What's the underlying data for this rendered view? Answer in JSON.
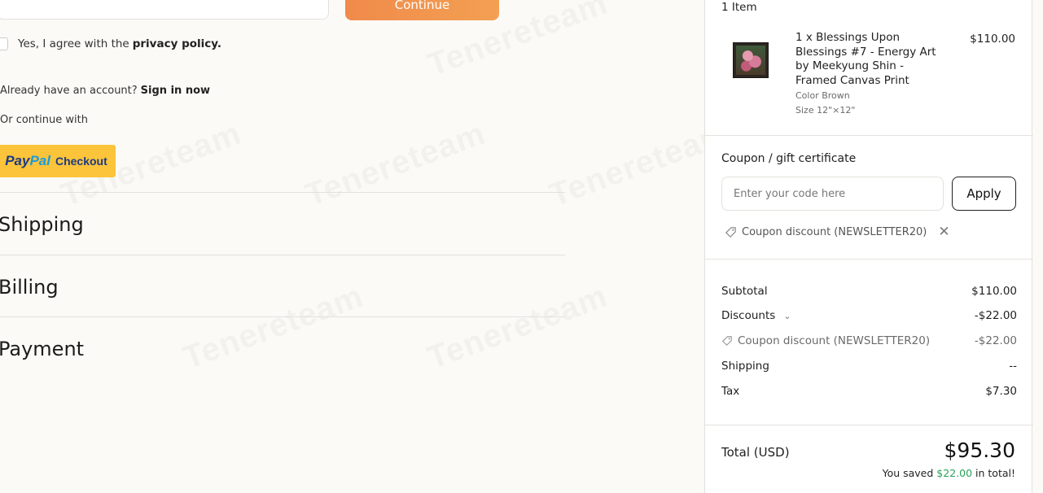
{
  "watermark": "Tenereteam",
  "auth": {
    "continue_label": "Continue",
    "agree_text": "Yes, I agree with the",
    "agree_link": "privacy policy.",
    "account_prompt": "Already have an account?",
    "sign_in_label": "Sign in now",
    "continue_with": "Or continue with",
    "paypal_pay": "Pay",
    "paypal_pal": "Pal",
    "paypal_checkout": "Checkout"
  },
  "sections": {
    "shipping": "Shipping",
    "billing": "Billing",
    "payment": "Payment"
  },
  "summary": {
    "items_count": "1 Item",
    "item": {
      "title": "1 x Blessings Upon Blessings #7 - Energy Art by Meekyung Shin - Framed Canvas Print",
      "price": "$110.00",
      "color": "Color Brown",
      "size": "Size 12\"×12\""
    },
    "coupon": {
      "label": "Coupon / gift certificate",
      "placeholder": "Enter your code here",
      "apply_label": "Apply",
      "applied": "Coupon discount (NEWSLETTER20)"
    },
    "rows": {
      "subtotal_label": "Subtotal",
      "subtotal_value": "$110.00",
      "discounts_label": "Discounts",
      "discounts_value": "-$22.00",
      "coupon_label": "Coupon discount (NEWSLETTER20)",
      "coupon_value": "-$22.00",
      "shipping_label": "Shipping",
      "shipping_value": "--",
      "tax_label": "Tax",
      "tax_value": "$7.30"
    },
    "total_label": "Total (USD)",
    "total_value": "$95.30",
    "saved_prefix": "You saved",
    "saved_amount": "$22.00",
    "saved_suffix": "in total!"
  }
}
